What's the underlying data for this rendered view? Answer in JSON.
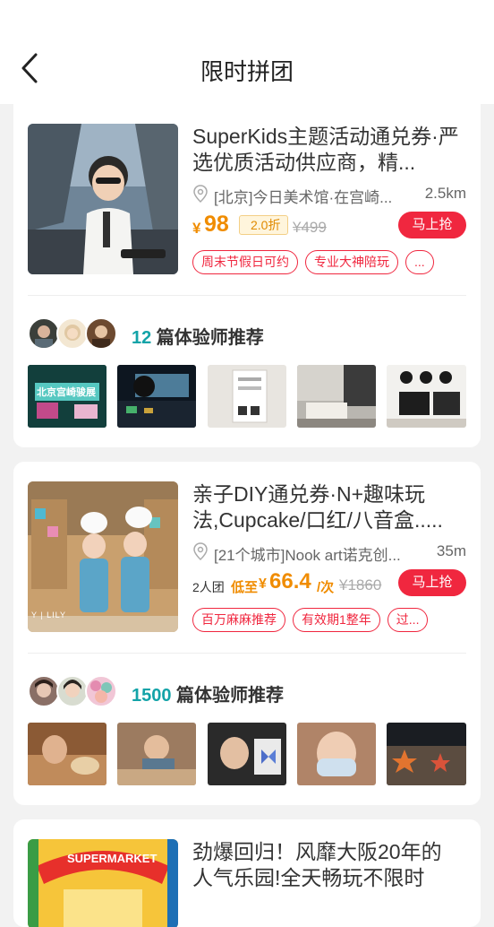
{
  "header": {
    "title": "限时拼团"
  },
  "cards": [
    {
      "title": "SuperKids主题活动通兑券·严选优质活动供应商，精...",
      "location": "[北京]今日美术馆·在宫崎...",
      "distance": "2.5km",
      "price_symbol": "¥",
      "price": "98",
      "discount": "2.0折",
      "original_price": "¥499",
      "buy_label": "马上抢",
      "tags": [
        "周末节假日可约",
        "专业大神陪玩",
        "..."
      ],
      "rec_count": "12",
      "rec_label": " 篇体验师推荐",
      "photo_caption": "北京宫崎骏展"
    },
    {
      "title": "亲子DIY通兑券·N+趣味玩法,Cupcake/口红/八音盒.....",
      "location": "[21个城市]Nook art诺克创...",
      "distance": "35m",
      "group_label": "2人团",
      "low_label": "低至",
      "price_symbol": "¥",
      "price": "66.4",
      "unit": "/次",
      "original_price": "¥1860",
      "buy_label": "马上抢",
      "tags": [
        "百万麻麻推荐",
        "有效期1整年",
        "过..."
      ],
      "rec_count": "1500",
      "rec_label": " 篇体验师推荐",
      "thumb_caption": "Y | LILY"
    },
    {
      "title": "劲爆回归！风靡大阪20年的人气乐园!全天畅玩不限时",
      "thumb_caption": "SUPERMARKET"
    }
  ],
  "colors": {
    "accent": "#f0273f",
    "price": "#f08c00",
    "teal": "#13a3a8"
  }
}
